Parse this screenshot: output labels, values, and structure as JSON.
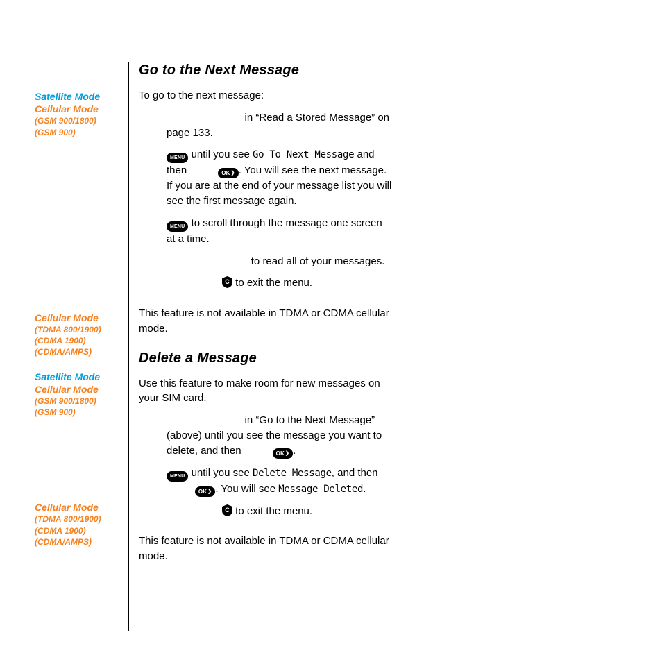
{
  "headings": {
    "h1": "Go to the Next Message",
    "h2": "Delete a Message"
  },
  "sidebar": {
    "block1": {
      "satellite": "Satellite Mode",
      "cellular": "Cellular Mode",
      "sub1": "(GSM 900/1800)",
      "sub2": "(GSM 900)"
    },
    "block2": {
      "cellular": "Cellular Mode",
      "sub1": "(TDMA 800/1900)",
      "sub2": "(CDMA 1900)",
      "sub3": "(CDMA/AMPS)"
    },
    "block3": {
      "satellite": "Satellite Mode",
      "cellular": "Cellular Mode",
      "sub1": "(GSM 900/1800)",
      "sub2": "(GSM 900)"
    },
    "block4": {
      "cellular": "Cellular Mode",
      "sub1": "(TDMA 800/1900)",
      "sub2": "(CDMA 1900)",
      "sub3": "(CDMA/AMPS)"
    }
  },
  "body": {
    "p1": "To go to the next message:",
    "s1a": " in “Read a Stored Message” on page 133.",
    "s2a": " until you see ",
    "s2a_ui": "Go To Next Message",
    "s2b": " and then ",
    "s2c": ". You will see the next message. If you are at the end of your message list you will see the first message again.",
    "s3a": " to scroll through the message one screen at a time.",
    "s4a": " to read all of your messages.",
    "s5a": " to exit the menu.",
    "p2": "This feature is not available in TDMA or CDMA cellular mode.",
    "p3": "Use this feature to make room for new messages on your SIM card.",
    "d1a": " in “Go to the Next Message” (above) until you see the message you want to delete, and then ",
    "d1b": ".",
    "d2a": " until you see ",
    "d2a_ui": "Delete Message",
    "d2b": ", and then ",
    "d2c": ". You will see ",
    "d2c_ui": "Message Deleted",
    "d2d": ".",
    "d3a": " to exit the menu."
  },
  "icons": {
    "menu": "MENU",
    "ok": "OK",
    "c": "C"
  }
}
